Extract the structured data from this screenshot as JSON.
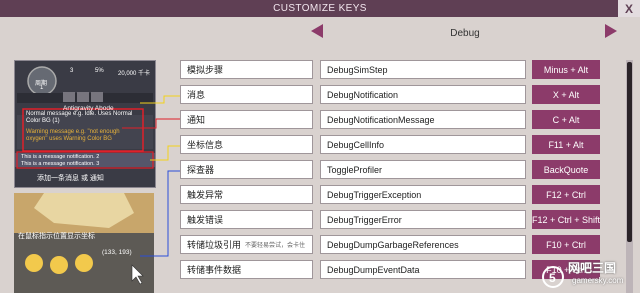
{
  "window": {
    "title": "CUSTOMIZE KEYS",
    "close_label": "X"
  },
  "category": "Debug",
  "tutorial": {
    "cycle_label": "周期",
    "cycle_number": "1",
    "duplicants": "3",
    "stress": "5%",
    "calories": "20,000 千卡",
    "asteroid": "Antigravity Abode",
    "msg_normal": "Normal message e.g. Idle. Uses Normal Color BG (1)",
    "msg_warning": "Warning message e.g. \"not enough oxygen\" uses Warning Color BG",
    "notif_2": "This is a message notification. 2",
    "notif_3": "This is a message notification. 3",
    "add_notification": "添加一条消息 或 通知",
    "cursor_caption": "在鼠标指示位置显示坐标",
    "coords": "(133, 193)"
  },
  "keybinds": [
    {
      "name": "模拟步骤",
      "note": "",
      "command": "DebugSimStep",
      "key": "Minus + Alt"
    },
    {
      "name": "消息",
      "note": "",
      "command": "DebugNotification",
      "key": "X + Alt"
    },
    {
      "name": "通知",
      "note": "",
      "command": "DebugNotificationMessage",
      "key": "C + Alt"
    },
    {
      "name": "坐标信息",
      "note": "",
      "command": "DebugCellInfo",
      "key": "F11 + Alt"
    },
    {
      "name": "探查器",
      "note": "",
      "command": "ToggleProfiler",
      "key": "BackQuote"
    },
    {
      "name": "触发异常",
      "note": "",
      "command": "DebugTriggerException",
      "key": "F12 + Ctrl"
    },
    {
      "name": "触发错误",
      "note": "",
      "command": "DebugTriggerError",
      "key": "F12 + Ctrl + Shift"
    },
    {
      "name": "转储垃圾引用",
      "note": "不要轻易尝试，会卡住",
      "command": "DebugDumpGarbageReferences",
      "key": "F10 + Ctrl"
    },
    {
      "name": "转储事件数据",
      "note": "",
      "command": "DebugDumpEventData",
      "key": "F10 + Ctrl"
    }
  ],
  "watermark": {
    "site": "网吧三国",
    "domain": "gamersky.com"
  },
  "colors": {
    "header": "#5f3f54",
    "accent": "#8c3b6a",
    "background": "#d9d2cf"
  }
}
